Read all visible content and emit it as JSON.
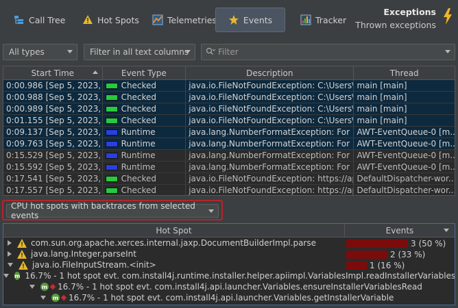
{
  "toolbar": {
    "buttons": [
      {
        "label": "Call Tree",
        "icon": "call-tree-icon"
      },
      {
        "label": "Hot Spots",
        "icon": "warning-icon"
      },
      {
        "label": "Telemetries",
        "icon": "telemetries-icon"
      },
      {
        "label": "Events",
        "icon": "star-icon",
        "active": true
      },
      {
        "label": "Tracker",
        "icon": "tracker-icon"
      }
    ],
    "exceptions_title": "Exceptions",
    "exceptions_subtitle": "Thrown exceptions"
  },
  "filters": {
    "type_select": "All types",
    "columns_select": "Filter in all text columns",
    "search_placeholder": "Filter"
  },
  "events_table": {
    "columns": [
      "Start Time",
      "Event Type",
      "Description",
      "Thread"
    ],
    "rows": [
      {
        "start": "0:00.986 [Sep 5, 2023, ...",
        "type": "Checked",
        "color": "#27c93f",
        "desc": "java.io.FileNotFoundException: C:\\Users\\ing...",
        "thread": "main [main]",
        "selected": true
      },
      {
        "start": "0:00.988 [Sep 5, 2023, ...",
        "type": "Checked",
        "color": "#27c93f",
        "desc": "java.io.FileNotFoundException: C:\\Users\\ing...",
        "thread": "main [main]",
        "selected": true
      },
      {
        "start": "0:00.989 [Sep 5, 2023, ...",
        "type": "Checked",
        "color": "#27c93f",
        "desc": "java.io.FileNotFoundException: C:\\Users\\ing...",
        "thread": "main [main]",
        "selected": true
      },
      {
        "start": "0:01.155 [Sep 5, 2023, ...",
        "type": "Checked",
        "color": "#27c93f",
        "desc": "java.io.FileNotFoundException: C:\\Users\\ing...",
        "thread": "main [main]",
        "selected": true
      },
      {
        "start": "0:09.137 [Sep 5, 2023, ...",
        "type": "Runtime",
        "color": "#2a3fe0",
        "desc": "java.lang.NumberFormatException: For inpu...",
        "thread": "AWT-EventQueue-0 [m...",
        "selected": true
      },
      {
        "start": "0:09.763 [Sep 5, 2023, ...",
        "type": "Runtime",
        "color": "#2a3fe0",
        "desc": "java.lang.NumberFormatException: For inpu...",
        "thread": "AWT-EventQueue-0 [m...",
        "selected": true
      },
      {
        "start": "0:15.529 [Sep 5, 2023, ...",
        "type": "Runtime",
        "color": "#2a3fe0",
        "desc": "java.lang.NumberFormatException: For inpu...",
        "thread": "AWT-EventQueue-0 [m...",
        "selected": false
      },
      {
        "start": "0:15.592 [Sep 5, 2023, ...",
        "type": "Runtime",
        "color": "#2a3fe0",
        "desc": "java.lang.NumberFormatException: For inpu...",
        "thread": "AWT-EventQueue-0 [m...",
        "selected": false
      },
      {
        "start": "0:17.541 [Sep 5, 2023, ...",
        "type": "Checked",
        "color": "#27c93f",
        "desc": "java.io.FileNotFoundException: https://api.a...",
        "thread": "DefaultDispatcher-wor...",
        "selected": false
      },
      {
        "start": "0:17.557 [Sep 5, 2023, ...",
        "type": "Checked",
        "color": "#27c93f",
        "desc": "java.io.FileNotFoundException: https://api.a...",
        "thread": "DefaultDispatcher-wor...",
        "selected": false
      }
    ]
  },
  "backtrace_select": "CPU hot spots with backtraces from selected events",
  "hotspots": {
    "columns": [
      "Hot Spot",
      "Events"
    ],
    "rows": [
      {
        "label": "com.sun.org.apache.xerces.internal.jaxp.DocumentBuilderImpl.parse",
        "kind": "warn",
        "expanded": false,
        "level": 0,
        "events": "3 (50 %)",
        "fraction": 0.5
      },
      {
        "label": "java.lang.Integer.parseInt",
        "kind": "warn",
        "expanded": false,
        "level": 0,
        "events": "2 (33 %)",
        "fraction": 0.333
      },
      {
        "label": "java.io.FileInputStream.<init>",
        "kind": "warn",
        "expanded": true,
        "level": 0,
        "events": "1 (16 %)",
        "fraction": 0.167
      },
      {
        "label": "16.7% - 1 hot spot evt. com.install4j.runtime.installer.helper.apiimpl.VariablesImpl.readInstallerVariables",
        "kind": "method",
        "expanded": true,
        "level": 1
      },
      {
        "label": "16.7% - 1 hot spot evt. com.install4j.api.launcher.Variables.ensureInstallerVariablesRead",
        "kind": "method",
        "expanded": true,
        "level": 2
      },
      {
        "label": "16.7% - 1 hot spot evt. com.install4j.api.launcher.Variables.getInstallerVariable",
        "kind": "method",
        "expanded": true,
        "level": 3
      }
    ]
  }
}
